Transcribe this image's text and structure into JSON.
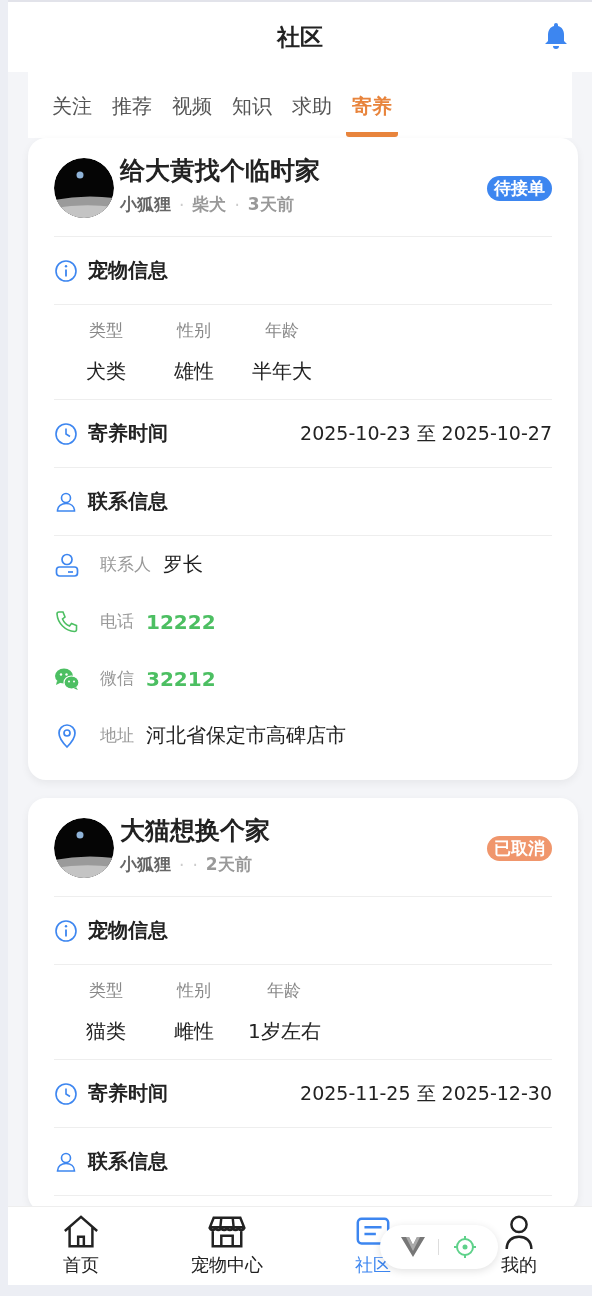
{
  "header": {
    "title": "社区"
  },
  "tabs": [
    {
      "label": "关注",
      "selected": false
    },
    {
      "label": "推荐",
      "selected": false
    },
    {
      "label": "视频",
      "selected": false
    },
    {
      "label": "知识",
      "selected": false
    },
    {
      "label": "求助",
      "selected": false
    },
    {
      "label": "寄养",
      "selected": true
    }
  ],
  "posts": [
    {
      "title": "给大黄找个临时家",
      "meta": [
        {
          "kind": "author",
          "text": "小狐狸"
        },
        {
          "kind": "separator",
          "text": "·"
        },
        {
          "kind": "info",
          "text": "柴犬"
        },
        {
          "kind": "separator",
          "text": "·"
        },
        {
          "kind": "info",
          "text": "3天前"
        }
      ],
      "status": {
        "label": "待接单",
        "color": "#3d86f0"
      },
      "pet_section": "宠物信息",
      "pet": [
        {
          "label": "类型",
          "value": "犬类"
        },
        {
          "label": "性别",
          "value": "雄性"
        },
        {
          "label": "年龄",
          "value": "半年大"
        }
      ],
      "time_section": "寄养时间",
      "period": "2025-10-23 至 2025-10-27",
      "contact_section": "联系信息",
      "contacts": [
        {
          "kind": "person",
          "label": "联系人",
          "value": "罗长"
        },
        {
          "kind": "phone",
          "label": "电话",
          "value": "12222"
        },
        {
          "kind": "wechat",
          "label": "微信",
          "value": "32212"
        },
        {
          "kind": "address",
          "label": "地址",
          "value": "河北省保定市高碑店市"
        }
      ]
    },
    {
      "title": "大猫想换个家",
      "meta": [
        {
          "kind": "author",
          "text": "小狐狸"
        },
        {
          "kind": "separator",
          "text": "·"
        },
        {
          "kind": "separator",
          "text": "·"
        },
        {
          "kind": "info",
          "text": "2天前"
        }
      ],
      "status": {
        "label": "已取消",
        "color": "#f0966c"
      },
      "pet_section": "宠物信息",
      "pet": [
        {
          "label": "类型",
          "value": "猫类"
        },
        {
          "label": "性别",
          "value": "雌性"
        },
        {
          "label": "年龄",
          "value": "1岁左右"
        }
      ],
      "time_section": "寄养时间",
      "period": "2025-11-25 至 2025-12-30",
      "contact_section": "联系信息"
    }
  ],
  "nav": [
    {
      "kind": "home",
      "label": "首页",
      "selected": false
    },
    {
      "kind": "shop",
      "label": "宠物中心",
      "selected": false
    },
    {
      "kind": "community",
      "label": "社区",
      "selected": true
    },
    {
      "kind": "profile",
      "label": "我的",
      "selected": false
    }
  ]
}
